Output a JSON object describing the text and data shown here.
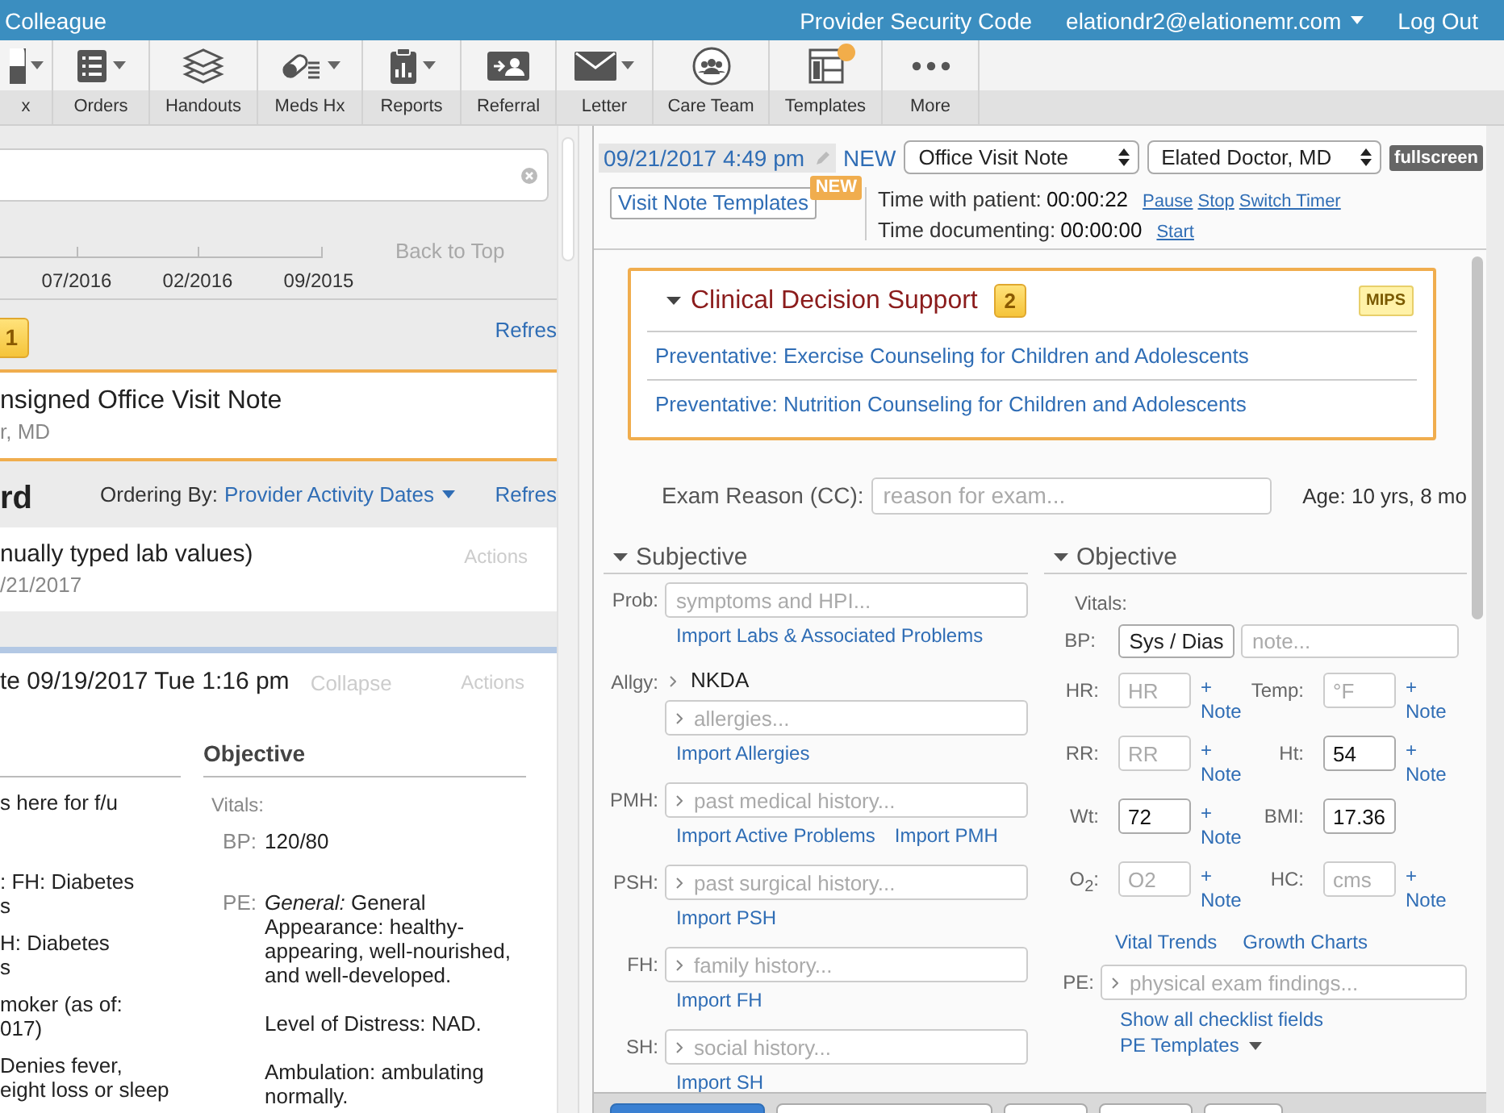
{
  "top_bar": {
    "app": "Colleague",
    "security": "Provider Security Code",
    "account": "elationdr2@elationemr.com",
    "logout": "Log Out"
  },
  "toolbar": [
    {
      "label": "x",
      "dropdown": true,
      "badge": false
    },
    {
      "label": "Orders",
      "dropdown": true,
      "badge": false
    },
    {
      "label": "Handouts",
      "dropdown": false,
      "badge": false
    },
    {
      "label": "Meds Hx",
      "dropdown": true,
      "badge": false
    },
    {
      "label": "Reports",
      "dropdown": true,
      "badge": false
    },
    {
      "label": "Referral",
      "dropdown": false,
      "badge": false
    },
    {
      "label": "Letter",
      "dropdown": true,
      "badge": false
    },
    {
      "label": "Care Team",
      "dropdown": false,
      "badge": false
    },
    {
      "label": "Templates",
      "dropdown": false,
      "badge": true
    },
    {
      "label": "More",
      "dropdown": false,
      "badge": false
    }
  ],
  "left": {
    "timeline": {
      "ticks": [
        "07/2016",
        "02/2016",
        "09/2015"
      ],
      "back_to_top": "Back to Top"
    },
    "alert": {
      "count": "1",
      "refresh": "Refres"
    },
    "unsigned": {
      "title": "nsigned Office Visit Note",
      "author": "r, MD"
    },
    "record": {
      "title": "rd",
      "ordering_label": "Ordering By:",
      "ordering_value": "Provider Activity Dates",
      "refresh": "Refres"
    },
    "entries": [
      {
        "title": "nually typed lab values)",
        "date": "/21/2017",
        "actions": "Actions"
      }
    ],
    "visit": {
      "title": "te 09/19/2017 Tue 1:16 pm",
      "collapse": "Collapse",
      "actions": "Actions",
      "left_paragraphs": [
        {
          "lines": [
            "s here for f/u"
          ]
        },
        {
          "lines": [
            ": FH: Diabetes",
            "s"
          ]
        },
        {
          "lines": [
            "H: Diabetes",
            "s"
          ]
        },
        {
          "lines": [
            "moker (as of:",
            "017)"
          ]
        },
        {
          "lines": [
            "Denies fever,",
            "eight loss or sleep"
          ]
        }
      ],
      "objective": {
        "title": "Objective",
        "vitals_label": "Vitals:",
        "rows": [
          {
            "label": "BP:",
            "paragraphs": [
              "120/80"
            ]
          },
          {
            "label": "PE:",
            "paragraphs": [
              "*General:* General Appearance: healthy-appearing, well-nourished, and well-developed.",
              "Level of Distress: NAD.",
              "Ambulation: ambulating normally."
            ]
          }
        ]
      }
    }
  },
  "right": {
    "header": {
      "datetime": "09/21/2017 4:49 pm",
      "status": "NEW",
      "note_type": "Office Visit Note",
      "provider": "Elated Doctor, MD",
      "fullscreen": "fullscreen"
    },
    "templates_button": {
      "label": "Visit Note Templates",
      "badge": "NEW"
    },
    "timers": [
      {
        "label": "Time with patient:",
        "value": "00:00:22",
        "actions": [
          "Pause",
          "Stop",
          "Switch Timer"
        ]
      },
      {
        "label": "Time documenting:",
        "value": "00:00:00",
        "actions": [
          "Start"
        ]
      }
    ],
    "cds": {
      "title": "Clinical Decision Support",
      "count": "2",
      "tag": "MIPS",
      "expanded": true,
      "items": [
        "Preventative: Exercise Counseling for Children and Adolescents",
        "Preventative: Nutrition Counseling for Children and Adolescents"
      ]
    },
    "exam_reason": {
      "label": "Exam Reason (CC):",
      "placeholder": "reason for exam...",
      "age": "Age: 10 yrs, 8 mo"
    },
    "subjective": {
      "title": "Subjective",
      "expanded": true,
      "rows": [
        {
          "label": "Prob:",
          "placeholder": "symptoms and HPI...",
          "chevron": false,
          "links": [
            "Import Labs & Associated Problems"
          ]
        },
        {
          "label": "Allgy:",
          "values": [
            "NKDA"
          ],
          "placeholder": "allergies...",
          "chevron": true,
          "links": [
            "Import Allergies"
          ]
        },
        {
          "label": "PMH:",
          "placeholder": "past medical history...",
          "chevron": true,
          "links": [
            "Import Active Problems",
            "Import PMH"
          ]
        },
        {
          "label": "PSH:",
          "placeholder": "past surgical history...",
          "chevron": true,
          "links": [
            "Import PSH"
          ]
        },
        {
          "label": "FH:",
          "placeholder": "family history...",
          "chevron": true,
          "links": [
            "Import FH"
          ]
        },
        {
          "label": "SH:",
          "placeholder": "social history...",
          "chevron": true,
          "links": [
            "Import SH"
          ]
        }
      ]
    },
    "objective": {
      "title": "Objective",
      "expanded": true,
      "vitals_label": "Vitals:",
      "bp": {
        "label": "BP:",
        "value": "Sys / Dias",
        "note_placeholder": "note..."
      },
      "vitals": [
        {
          "label": "HR:",
          "placeholder": "HR",
          "note": "+ Note"
        },
        {
          "label": "Temp:",
          "placeholder": "°F",
          "note": "+ Note"
        },
        {
          "label": "RR:",
          "placeholder": "RR",
          "note": "+ Note"
        },
        {
          "label": "Ht:",
          "value": "54",
          "note": "+ Note"
        },
        {
          "label": "Wt:",
          "value": "72",
          "note": "+ Note"
        },
        {
          "label": "BMI:",
          "value": "17.36"
        },
        {
          "label": "O$_{2}$:",
          "placeholder": "O2",
          "note": "+ Note"
        },
        {
          "label": "HC:",
          "placeholder": "cms",
          "note": "+ Note"
        }
      ],
      "links": [
        "Vital Trends",
        "Growth Charts"
      ],
      "pe": {
        "label": "PE:",
        "placeholder": "physical exam findings..."
      },
      "pe_links": [
        {
          "label": "Show all checklist fields",
          "dropdown": false
        },
        {
          "label": "PE Templates",
          "dropdown": true
        }
      ]
    },
    "footer_buttons": [
      {
        "kind": "primary"
      },
      {
        "kind": "default"
      },
      {
        "kind": "default"
      },
      {
        "kind": "default"
      },
      {
        "kind": "default"
      }
    ]
  }
}
